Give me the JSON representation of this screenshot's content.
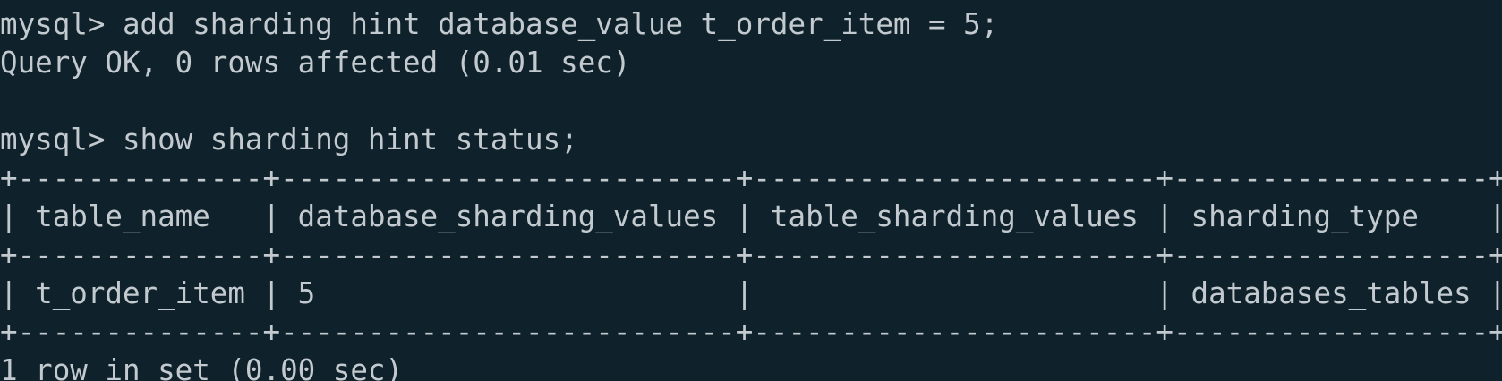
{
  "terminal": {
    "lines": [
      "mysql> add sharding hint database_value t_order_item = 5;",
      "Query OK, 0 rows affected (0.01 sec)",
      "mysql> show sharding hint status;",
      "+--------------+--------------------------+-----------------------+------------------+",
      "| table_name   | database_sharding_values | table_sharding_values | sharding_type    |",
      "+--------------+--------------------------+-----------------------+------------------+",
      "| t_order_item | 5                        |                       | databases_tables |",
      "+--------------+--------------------------+-----------------------+------------------+",
      "1 row in set (0.00 sec)"
    ]
  }
}
